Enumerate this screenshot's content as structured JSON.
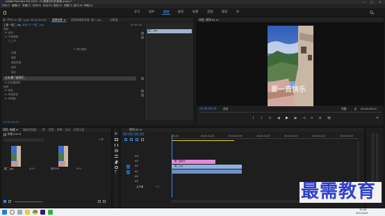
{
  "app": {
    "title": "Adobe Premiere Pro 2020 - D:\\新建文件夹\\新建.prproj *",
    "window_controls": [
      "—",
      "□",
      "✕"
    ]
  },
  "menu": [
    "文件(F)",
    "编辑(E)",
    "剪辑(C)",
    "序列(S)",
    "标记(M)",
    "图形(G)",
    "视图(V)",
    "窗口(W)",
    "帮助(H)"
  ],
  "workspaces": [
    "学习",
    "组件",
    "编辑",
    "颜色",
    "效果",
    "音频",
    "图形",
    "库"
  ],
  "workspace_active_index": 2,
  "source_panel": {
    "tabs": [
      "源: 序列 01: 图二.jpg: 00:00:00:00",
      "效果控件 ≡",
      "音频剪辑混合器: 图二.jpg",
      "元数据"
    ],
    "active_tab_index": 1,
    "clip_header": "主要 * 图二.jpg",
    "clip_path": "序列 01 * 图二.jpg",
    "clip_time": "00:00:00",
    "video_label": "视频",
    "rows": [
      "fx 运动",
      "fx 不透明度",
      "○ □ ✎",
      "fx 时间重映射",
      "音频",
      "fx 音量",
      "fx 声道音量",
      "fx 声像器"
    ],
    "motion_label": "运动",
    "opacity_label": "不透明度",
    "props": [
      "位置",
      "缩放",
      "缩放宽度",
      "旋转",
      "锚点",
      "防闪烁滤镜"
    ],
    "uniform_scale": "☐ 等比缩放",
    "highlight_row": "文本(要一直快乐)",
    "time_remap": "时间重映射",
    "audio_label": "音频",
    "audio_rows": [
      "音量",
      "声道音量",
      "声像器"
    ],
    "mini_clip_label": "图二.jpg",
    "timecode": "00:00:00:00"
  },
  "program_panel": {
    "title": "节目: 序列 01 ≡",
    "overlay_text": "要一直快乐",
    "timecode_left": "00:00:00:00",
    "fit_label": "适合",
    "quality_label": "完整",
    "timecode_right": "00:00:09:01",
    "transport": [
      "{",
      "}",
      "|←",
      "◀|",
      "▶",
      "|▶",
      "→|",
      "⊡",
      "⊞",
      "📷",
      "+"
    ]
  },
  "project_panel": {
    "tabs": [
      "项目: 新建 ≡",
      "媒体浏览器",
      "库",
      "信息",
      "效果",
      "标记",
      "历史记录"
    ],
    "active_tab_index": 0,
    "project_file": "新建.prproj",
    "item_count": "1 项",
    "bins": [
      {
        "name": "图二.jpg",
        "duration": "4:29"
      },
      {
        "name": "序列 01",
        "duration": "9:01"
      }
    ]
  },
  "timeline_panel": {
    "title": "序列 01 ≡",
    "timecode": "00:00:00:00",
    "ruler": [
      "00:00",
      "00:00:04:29",
      "00:00:09:29",
      "00:00:14:29",
      "00:00:19:29",
      "00:00:24:29",
      "00:00:29:29"
    ],
    "tracks": [
      "V3",
      "V2",
      "V1",
      "A1",
      "A2",
      "A3"
    ],
    "master_label": "主声道",
    "master_value": "0.0",
    "clips": [
      {
        "track": "V2",
        "label": "要一直快乐",
        "color": "#e38bd7"
      },
      {
        "track": "V1",
        "label": "图二.jpg",
        "color": "#8fb0e0"
      },
      {
        "track": "A1",
        "label": "",
        "color": "#6f8fc6"
      }
    ]
  },
  "watermark": "最需教育",
  "taskbar": {
    "time": "15:40",
    "date": "2021/3/24"
  },
  "colors": {
    "accent": "#3a8ee6",
    "panel_bg": "#1e1e1e",
    "clip_pink": "#e38bd7",
    "clip_blue": "#8fb0e0",
    "watermark": "#2f3fd0"
  }
}
